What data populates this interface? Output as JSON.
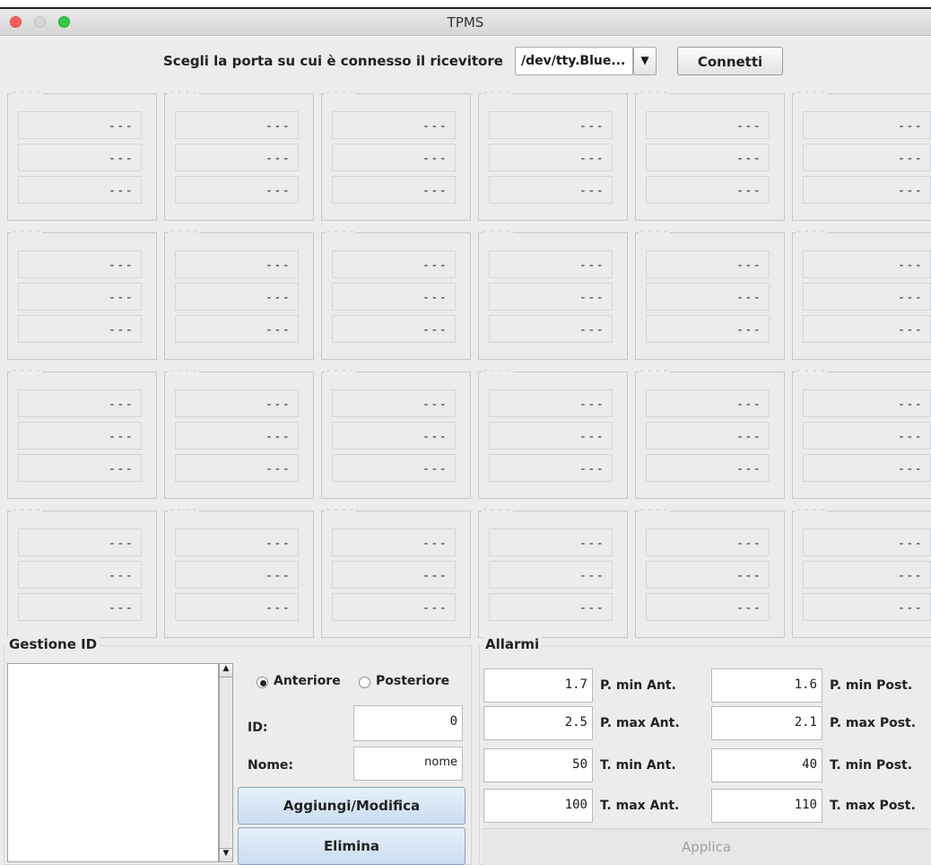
{
  "window": {
    "title": "TPMS"
  },
  "port": {
    "label": "Scegli la porta su cui è connesso il ricevitore",
    "selected": "/dev/tty.Blue...",
    "connect_label": "Connetti"
  },
  "grid": {
    "placeholder_title": "- - - -",
    "value_placeholder": "---",
    "rows": 4,
    "cols": 6
  },
  "id_management": {
    "title": "Gestione ID",
    "front_label": "Anteriore",
    "rear_label": "Posteriore",
    "front_selected": true,
    "id_label": "ID:",
    "id_value": "0",
    "name_label": "Nome:",
    "name_value": "nome",
    "add_modify_label": "Aggiungi/Modifica",
    "delete_label": "Elimina"
  },
  "alarms": {
    "title": "Allarmi",
    "p_min_front": {
      "value": "1.7",
      "label": "P. min Ant."
    },
    "p_min_rear": {
      "value": "1.6",
      "label": "P. min Post."
    },
    "p_max_front": {
      "value": "2.5",
      "label": "P. max Ant."
    },
    "p_max_rear": {
      "value": "2.1",
      "label": "P. max Post."
    },
    "t_min_front": {
      "value": "50",
      "label": "T. min Ant."
    },
    "t_min_rear": {
      "value": "40",
      "label": "T. min Post."
    },
    "t_max_front": {
      "value": "100",
      "label": "T. max Ant."
    },
    "t_max_rear": {
      "value": "110",
      "label": "T. max Post."
    },
    "apply_label": "Applica"
  },
  "colors": {
    "close": "#fc605c",
    "minimize_disabled": "#d6d6d6",
    "zoom": "#34c84a"
  }
}
